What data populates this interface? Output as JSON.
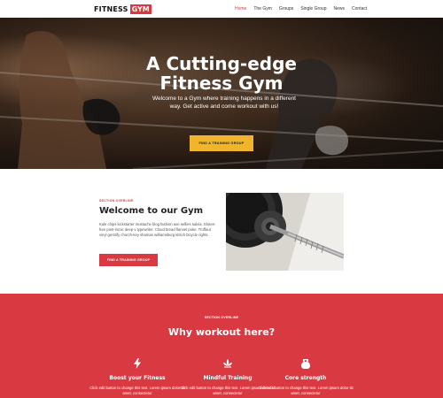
{
  "logo": {
    "text": "FITNESS",
    "badge": "GYM"
  },
  "nav": {
    "items": [
      {
        "label": "Home"
      },
      {
        "label": "The Gym"
      },
      {
        "label": "Groups"
      },
      {
        "label": "Single Group"
      },
      {
        "label": "News"
      },
      {
        "label": "Contact"
      }
    ],
    "active": "Home"
  },
  "hero": {
    "title_line1": "A Cutting-edge",
    "title_line2": "Fitness Gym",
    "subtitle": "Welcome to a Gym where training happens in a different way. Get active and come workout with us!",
    "button": "FIND A TRAINING GROUP"
  },
  "welcome": {
    "overline": "SECTION OVERLINE",
    "title": "Welcome to our Gym",
    "text": "Kale chips kickstarter mustache blog fashion axe selfies salvia. Gluten-free post-ironic deep v typewriter. Cloud bread flannel poke. Truffaut vinyl gentrify church-key shaman williamsburg kitsch bicycle rights.",
    "button": "FIND A TRAINING GROUP"
  },
  "why": {
    "overline": "SECTION OVERLINE",
    "title": "Why workout here?",
    "features": [
      {
        "icon": "lightning-icon",
        "title": "Boost your Fitness",
        "text": "Click edit button to change this text. Lorem ipsum dolor sit amet, consectetur"
      },
      {
        "icon": "lotus-icon",
        "title": "Mindful Training",
        "text": "Click edit button to change this text. Lorem ipsum dolor sit amet, consectetur"
      },
      {
        "icon": "kettlebell-icon",
        "title": "Core strength",
        "text": "Click edit button to change this text. Lorem ipsum dolor sit amet, consectetur"
      }
    ]
  },
  "colors": {
    "accent": "#d93a42",
    "button_yellow": "#f0b52a",
    "dark_text": "#222222"
  }
}
